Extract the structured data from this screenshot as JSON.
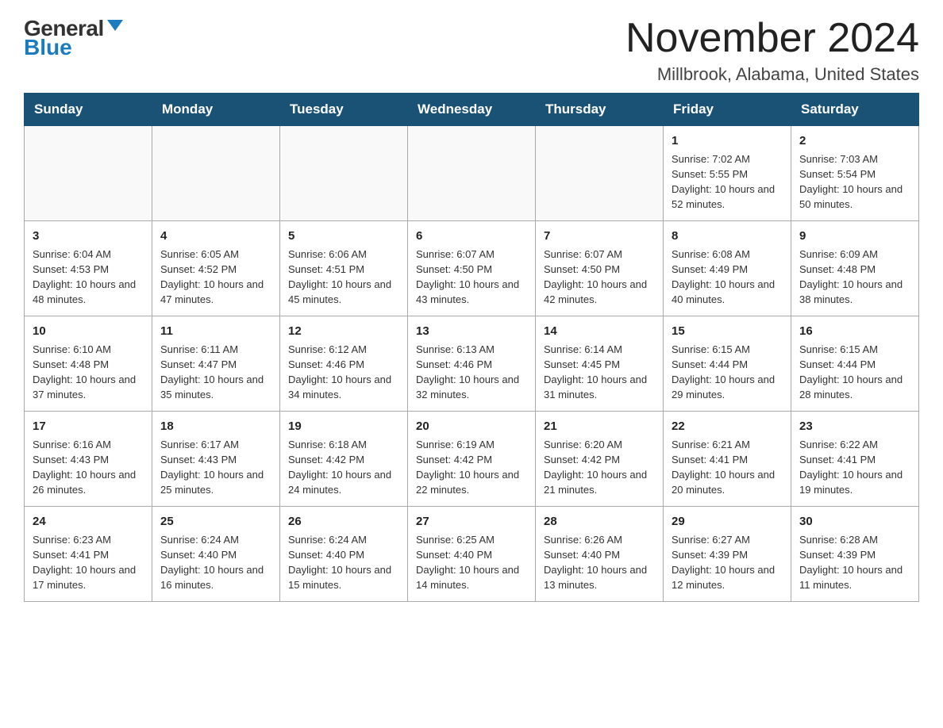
{
  "logo": {
    "general": "General",
    "blue": "Blue"
  },
  "header": {
    "month_title": "November 2024",
    "location": "Millbrook, Alabama, United States"
  },
  "weekdays": [
    "Sunday",
    "Monday",
    "Tuesday",
    "Wednesday",
    "Thursday",
    "Friday",
    "Saturday"
  ],
  "weeks": [
    [
      {
        "day": "",
        "info": ""
      },
      {
        "day": "",
        "info": ""
      },
      {
        "day": "",
        "info": ""
      },
      {
        "day": "",
        "info": ""
      },
      {
        "day": "",
        "info": ""
      },
      {
        "day": "1",
        "info": "Sunrise: 7:02 AM\nSunset: 5:55 PM\nDaylight: 10 hours and 52 minutes."
      },
      {
        "day": "2",
        "info": "Sunrise: 7:03 AM\nSunset: 5:54 PM\nDaylight: 10 hours and 50 minutes."
      }
    ],
    [
      {
        "day": "3",
        "info": "Sunrise: 6:04 AM\nSunset: 4:53 PM\nDaylight: 10 hours and 48 minutes."
      },
      {
        "day": "4",
        "info": "Sunrise: 6:05 AM\nSunset: 4:52 PM\nDaylight: 10 hours and 47 minutes."
      },
      {
        "day": "5",
        "info": "Sunrise: 6:06 AM\nSunset: 4:51 PM\nDaylight: 10 hours and 45 minutes."
      },
      {
        "day": "6",
        "info": "Sunrise: 6:07 AM\nSunset: 4:50 PM\nDaylight: 10 hours and 43 minutes."
      },
      {
        "day": "7",
        "info": "Sunrise: 6:07 AM\nSunset: 4:50 PM\nDaylight: 10 hours and 42 minutes."
      },
      {
        "day": "8",
        "info": "Sunrise: 6:08 AM\nSunset: 4:49 PM\nDaylight: 10 hours and 40 minutes."
      },
      {
        "day": "9",
        "info": "Sunrise: 6:09 AM\nSunset: 4:48 PM\nDaylight: 10 hours and 38 minutes."
      }
    ],
    [
      {
        "day": "10",
        "info": "Sunrise: 6:10 AM\nSunset: 4:48 PM\nDaylight: 10 hours and 37 minutes."
      },
      {
        "day": "11",
        "info": "Sunrise: 6:11 AM\nSunset: 4:47 PM\nDaylight: 10 hours and 35 minutes."
      },
      {
        "day": "12",
        "info": "Sunrise: 6:12 AM\nSunset: 4:46 PM\nDaylight: 10 hours and 34 minutes."
      },
      {
        "day": "13",
        "info": "Sunrise: 6:13 AM\nSunset: 4:46 PM\nDaylight: 10 hours and 32 minutes."
      },
      {
        "day": "14",
        "info": "Sunrise: 6:14 AM\nSunset: 4:45 PM\nDaylight: 10 hours and 31 minutes."
      },
      {
        "day": "15",
        "info": "Sunrise: 6:15 AM\nSunset: 4:44 PM\nDaylight: 10 hours and 29 minutes."
      },
      {
        "day": "16",
        "info": "Sunrise: 6:15 AM\nSunset: 4:44 PM\nDaylight: 10 hours and 28 minutes."
      }
    ],
    [
      {
        "day": "17",
        "info": "Sunrise: 6:16 AM\nSunset: 4:43 PM\nDaylight: 10 hours and 26 minutes."
      },
      {
        "day": "18",
        "info": "Sunrise: 6:17 AM\nSunset: 4:43 PM\nDaylight: 10 hours and 25 minutes."
      },
      {
        "day": "19",
        "info": "Sunrise: 6:18 AM\nSunset: 4:42 PM\nDaylight: 10 hours and 24 minutes."
      },
      {
        "day": "20",
        "info": "Sunrise: 6:19 AM\nSunset: 4:42 PM\nDaylight: 10 hours and 22 minutes."
      },
      {
        "day": "21",
        "info": "Sunrise: 6:20 AM\nSunset: 4:42 PM\nDaylight: 10 hours and 21 minutes."
      },
      {
        "day": "22",
        "info": "Sunrise: 6:21 AM\nSunset: 4:41 PM\nDaylight: 10 hours and 20 minutes."
      },
      {
        "day": "23",
        "info": "Sunrise: 6:22 AM\nSunset: 4:41 PM\nDaylight: 10 hours and 19 minutes."
      }
    ],
    [
      {
        "day": "24",
        "info": "Sunrise: 6:23 AM\nSunset: 4:41 PM\nDaylight: 10 hours and 17 minutes."
      },
      {
        "day": "25",
        "info": "Sunrise: 6:24 AM\nSunset: 4:40 PM\nDaylight: 10 hours and 16 minutes."
      },
      {
        "day": "26",
        "info": "Sunrise: 6:24 AM\nSunset: 4:40 PM\nDaylight: 10 hours and 15 minutes."
      },
      {
        "day": "27",
        "info": "Sunrise: 6:25 AM\nSunset: 4:40 PM\nDaylight: 10 hours and 14 minutes."
      },
      {
        "day": "28",
        "info": "Sunrise: 6:26 AM\nSunset: 4:40 PM\nDaylight: 10 hours and 13 minutes."
      },
      {
        "day": "29",
        "info": "Sunrise: 6:27 AM\nSunset: 4:39 PM\nDaylight: 10 hours and 12 minutes."
      },
      {
        "day": "30",
        "info": "Sunrise: 6:28 AM\nSunset: 4:39 PM\nDaylight: 10 hours and 11 minutes."
      }
    ]
  ]
}
